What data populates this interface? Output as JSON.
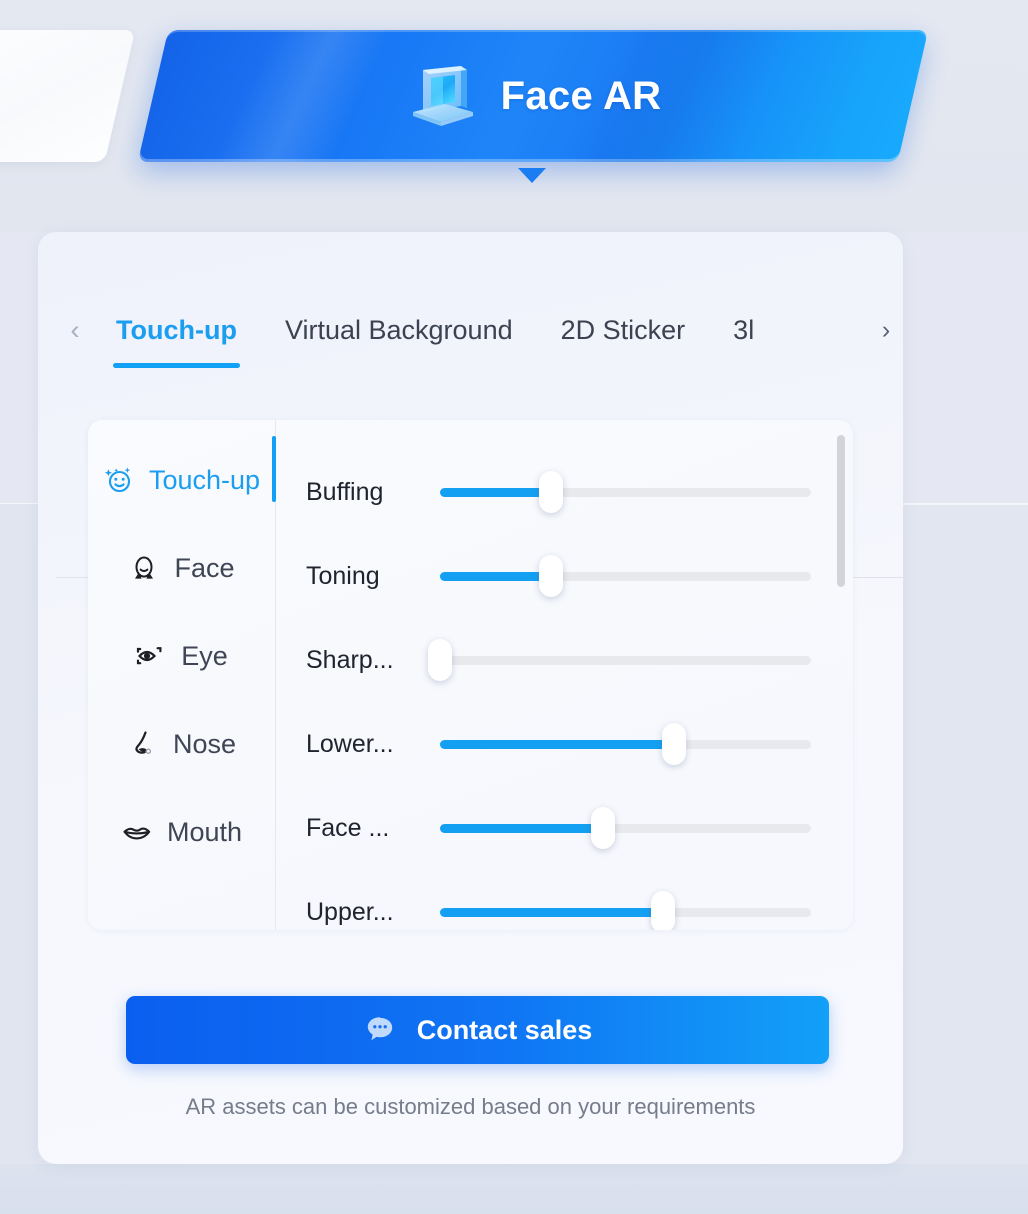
{
  "header": {
    "title": "Face AR",
    "icon": "ar-screen-icon",
    "active_accent": "#1877f5",
    "inactive_tab_color": "#ffffff",
    "caret_color": "#1a7ef2"
  },
  "tabs": {
    "prev_icon": "chevron-left-icon",
    "next_icon": "chevron-right-icon",
    "active_index": 0,
    "items": [
      {
        "label": "Touch-up"
      },
      {
        "label": "Virtual Background"
      },
      {
        "label": "2D Sticker"
      },
      {
        "label": "3l"
      }
    ]
  },
  "sidebar": {
    "active_index": 0,
    "items": [
      {
        "label": "Touch-up",
        "icon": "smiley-sparkle-icon"
      },
      {
        "label": "Face",
        "icon": "face-icon"
      },
      {
        "label": "Eye",
        "icon": "eye-icon"
      },
      {
        "label": "Nose",
        "icon": "nose-icon"
      },
      {
        "label": "Mouth",
        "icon": "mouth-icon"
      }
    ]
  },
  "sliders": [
    {
      "label": "Buffing",
      "value": 30
    },
    {
      "label": "Toning",
      "value": 30
    },
    {
      "label": "Sharp...",
      "value": 0
    },
    {
      "label": "Lower...",
      "value": 63
    },
    {
      "label": "Face ...",
      "value": 44
    },
    {
      "label": "Upper...",
      "value": 60
    }
  ],
  "scrollbar": {
    "thumb_top_pct": 1,
    "thumb_height_pct": 31
  },
  "cta": {
    "label": "Contact sales",
    "icon": "chat-bubble-icon",
    "caption": "AR assets can be customized based on your requirements",
    "accent_start": "#0b5ff0",
    "accent_end": "#12a0f8"
  },
  "colors": {
    "page_background": "#e2e6ef",
    "panel_background": "#f4f6fd",
    "slider_fill": "#14a0f2",
    "slider_track": "#e8e9ec",
    "active_blue": "#11a0f3",
    "text_primary": "#20242e",
    "text_muted": "#767c8b"
  }
}
